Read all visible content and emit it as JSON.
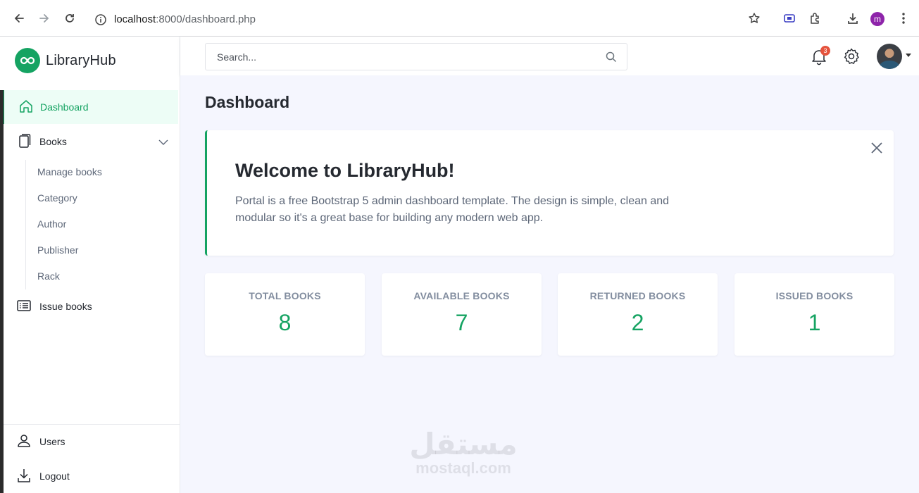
{
  "browser": {
    "url_host": "localhost",
    "url_path": ":8000/dashboard.php",
    "profile_initial": "m"
  },
  "brand": {
    "name": "LibraryHub"
  },
  "sidebar": {
    "items": [
      {
        "label": "Dashboard",
        "icon": "house-icon",
        "active": true
      },
      {
        "label": "Books",
        "icon": "book-icon",
        "expanded": true
      },
      {
        "label": "Issue books",
        "icon": "list-icon"
      }
    ],
    "books_submenu": [
      "Manage books",
      "Category",
      "Author",
      "Publisher",
      "Rack"
    ],
    "footer": [
      {
        "label": "Users",
        "icon": "person-icon"
      },
      {
        "label": "Logout",
        "icon": "download-icon"
      }
    ]
  },
  "header": {
    "search_placeholder": "Search...",
    "notification_count": "3"
  },
  "page": {
    "title": "Dashboard"
  },
  "welcome": {
    "title": "Welcome to LibraryHub!",
    "text": "Portal is a free Bootstrap 5 admin dashboard template. The design is simple, clean and modular so it's a great base for building any modern web app."
  },
  "stats": [
    {
      "label": "TOTAL BOOKS",
      "value": "8"
    },
    {
      "label": "AVAILABLE BOOKS",
      "value": "7"
    },
    {
      "label": "RETURNED BOOKS",
      "value": "2"
    },
    {
      "label": "ISSUED BOOKS",
      "value": "1"
    }
  ],
  "watermark": {
    "arabic": "مستقل",
    "latin": "mostaql.com"
  },
  "colors": {
    "accent": "#15a362",
    "badge": "#e5533d",
    "main_bg": "#f5f6fe"
  }
}
